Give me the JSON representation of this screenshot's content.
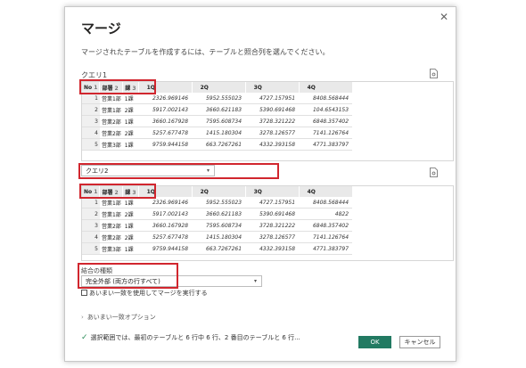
{
  "dialog": {
    "title": "マージ",
    "close_icon": "close-icon",
    "description": "マージされたテーブルを作成するには、テーブルと照合列を選んでください。"
  },
  "table1": {
    "name": "クエリ1",
    "headers": {
      "no": "No",
      "no_idx": "1",
      "dept": "部署",
      "dept_idx": "2",
      "ka": "課",
      "ka_idx": "3",
      "q1": "1Q",
      "q2": "2Q",
      "q3": "3Q",
      "q4": "4Q"
    },
    "rows": [
      {
        "no": "1",
        "dept": "営業1部",
        "ka": "1課",
        "q1": "2326.969146",
        "q2": "5952.555023",
        "q3": "4727.157951",
        "q4": "8408.568444"
      },
      {
        "no": "2",
        "dept": "営業1部",
        "ka": "2課",
        "q1": "5917.002143",
        "q2": "3660.621183",
        "q3": "5390.691468",
        "q4": "104.6543153"
      },
      {
        "no": "3",
        "dept": "営業2部",
        "ka": "1課",
        "q1": "3660.167928",
        "q2": "7595.608734",
        "q3": "3728.321222",
        "q4": "6848.357402"
      },
      {
        "no": "4",
        "dept": "営業2部",
        "ka": "2課",
        "q1": "5257.677478",
        "q2": "1415.180304",
        "q3": "3278.126577",
        "q4": "7141.126764"
      },
      {
        "no": "5",
        "dept": "営業3部",
        "ka": "1課",
        "q1": "9759.944158",
        "q2": "663.7267261",
        "q3": "4332.393158",
        "q4": "4771.383797"
      }
    ]
  },
  "table2": {
    "selected_query": "クエリ2",
    "headers": {
      "no": "No",
      "no_idx": "1",
      "dept": "部署",
      "dept_idx": "2",
      "ka": "課",
      "ka_idx": "3",
      "q1": "1Q",
      "q2": "2Q",
      "q3": "3Q",
      "q4": "4Q"
    },
    "rows": [
      {
        "no": "1",
        "dept": "営業1部",
        "ka": "1課",
        "q1": "2326.969146",
        "q2": "5952.555023",
        "q3": "4727.157951",
        "q4": "8408.568444"
      },
      {
        "no": "2",
        "dept": "営業1部",
        "ka": "2課",
        "q1": "5917.002143",
        "q2": "3660.621183",
        "q3": "5390.691468",
        "q4": "4822"
      },
      {
        "no": "3",
        "dept": "営業2部",
        "ka": "1課",
        "q1": "3660.167928",
        "q2": "7595.608734",
        "q3": "3728.321222",
        "q4": "6848.357402"
      },
      {
        "no": "4",
        "dept": "営業2部",
        "ka": "2課",
        "q1": "5257.677478",
        "q2": "1415.180304",
        "q3": "3278.126577",
        "q4": "7141.126764"
      },
      {
        "no": "5",
        "dept": "営業3部",
        "ka": "1課",
        "q1": "9759.944158",
        "q2": "663.7267261",
        "q3": "4332.393158",
        "q4": "4771.383797"
      }
    ]
  },
  "join": {
    "label": "結合の種類",
    "selected": "完全外部 (両方の行すべて)"
  },
  "fuzzy_checkbox_label": "あいまい一致を使用してマージを実行する",
  "fuzzy_options_label": "あいまい一致オプション",
  "status_text": "選択範囲では、最初のテーブルと 6 行中 6 行、2 番目のテーブルと 6 行...",
  "buttons": {
    "ok": "OK",
    "cancel": "キャンセル"
  },
  "colors": {
    "accent": "#227a62",
    "highlight": "#d1262e",
    "header_bg": "#e9e9e9"
  }
}
